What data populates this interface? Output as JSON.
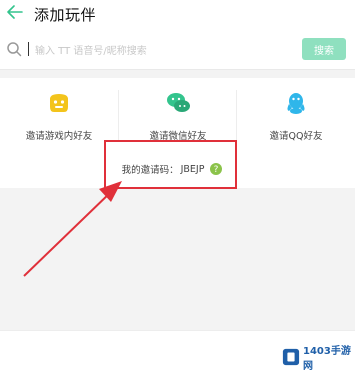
{
  "header": {
    "title": "添加玩伴"
  },
  "search": {
    "placeholder": "输入 TT 语音号/昵称搜索",
    "button_label": "搜索"
  },
  "invite": {
    "items": [
      {
        "label": "邀请游戏内好友",
        "icon": "game-controller-icon",
        "color": "#f3c41c"
      },
      {
        "label": "邀请微信好友",
        "icon": "wechat-icon",
        "color": "#33c48d"
      },
      {
        "label": "邀请QQ好友",
        "icon": "qq-icon",
        "color": "#2fb6ea"
      }
    ],
    "code_label": "我的邀请码：",
    "code_value": "JBEJP"
  },
  "colors": {
    "accent": "#33c48d",
    "highlight": "#e0303a",
    "search_button": "#8fe0bf"
  },
  "watermark": {
    "text": "1403手游网"
  }
}
